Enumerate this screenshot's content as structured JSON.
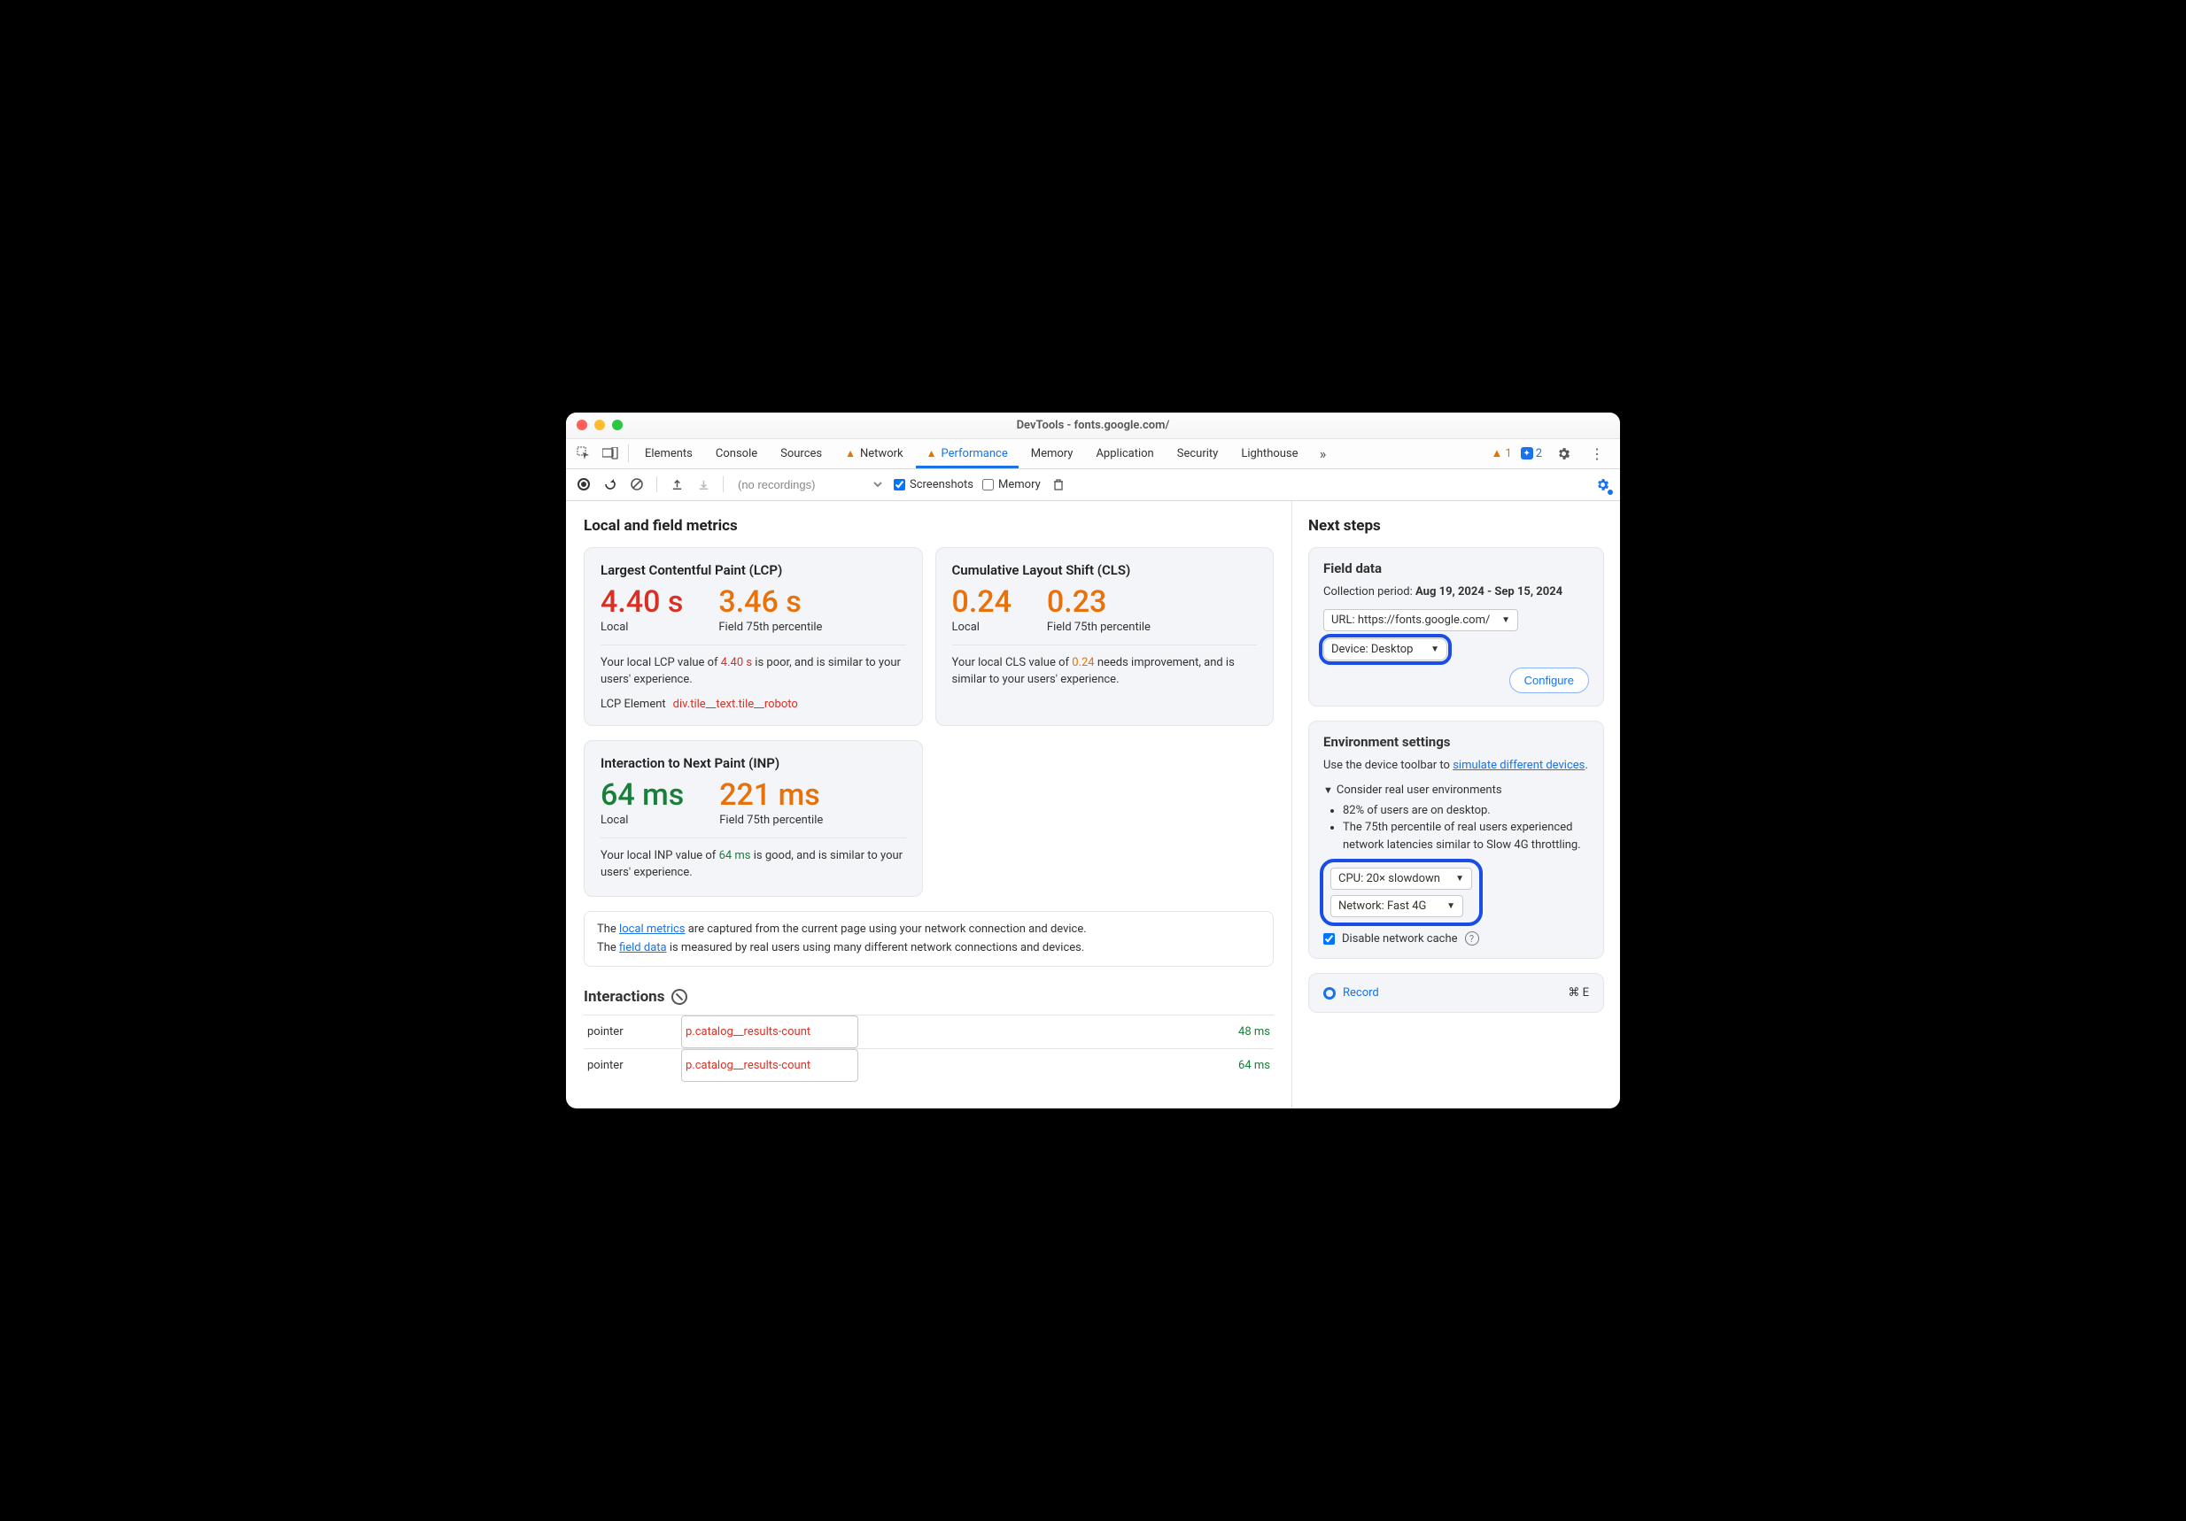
{
  "window_title": "DevTools - fonts.google.com/",
  "tabs": {
    "elements": "Elements",
    "console": "Console",
    "sources": "Sources",
    "network": "Network",
    "performance": "Performance",
    "memory": "Memory",
    "application": "Application",
    "security": "Security",
    "lighthouse": "Lighthouse"
  },
  "top_badges": {
    "warn_count": "1",
    "info_count": "2"
  },
  "toolbar": {
    "recording_placeholder": "(no recordings)",
    "screenshots_label": "Screenshots",
    "memory_label": "Memory"
  },
  "left": {
    "heading": "Local and field metrics",
    "lcp": {
      "title": "Largest Contentful Paint (LCP)",
      "local_val": "4.40 s",
      "local_label": "Local",
      "field_val": "3.46 s",
      "field_label": "Field 75th percentile",
      "desc_a": "Your local LCP value of ",
      "desc_val": "4.40 s",
      "desc_b": " is poor, and is similar to your users' experience.",
      "el_key": "LCP Element",
      "el_val": "div.tile__text.tile__roboto"
    },
    "cls": {
      "title": "Cumulative Layout Shift (CLS)",
      "local_val": "0.24",
      "local_label": "Local",
      "field_val": "0.23",
      "field_label": "Field 75th percentile",
      "desc_a": "Your local CLS value of ",
      "desc_val": "0.24",
      "desc_b": " needs improvement, and is similar to your users' experience."
    },
    "inp": {
      "title": "Interaction to Next Paint (INP)",
      "local_val": "64 ms",
      "local_label": "Local",
      "field_val": "221 ms",
      "field_label": "Field 75th percentile",
      "desc_a": "Your local INP value of ",
      "desc_val": "64 ms",
      "desc_b": " is good, and is similar to your users' experience."
    },
    "note": {
      "l1a": "The ",
      "l1_link": "local metrics",
      "l1b": " are captured from the current page using your network connection and device.",
      "l2a": "The ",
      "l2_link": "field data",
      "l2b": " is measured by real users using many different network connections and devices."
    },
    "interactions_heading": "Interactions",
    "interactions": [
      {
        "type": "pointer",
        "selector": "p.catalog__results-count",
        "time": "48 ms"
      },
      {
        "type": "pointer",
        "selector": "p.catalog__results-count",
        "time": "64 ms"
      }
    ]
  },
  "right": {
    "heading": "Next steps",
    "field": {
      "title": "Field data",
      "period_a": "Collection period: ",
      "period_b": "Aug 19, 2024 - Sep 15, 2024",
      "url_select": "URL: https://fonts.google.com/",
      "device_select": "Device: Desktop",
      "configure": "Configure"
    },
    "env": {
      "title": "Environment settings",
      "hint_a": "Use the device toolbar to ",
      "hint_link": "simulate different devices",
      "hint_b": ".",
      "details_summary": "Consider real user environments",
      "bullet1": "82% of users are on desktop.",
      "bullet2": "The 75th percentile of real users experienced network latencies similar to Slow 4G throttling.",
      "cpu_select": "CPU: 20× slowdown",
      "net_select": "Network: Fast 4G",
      "disable_cache": "Disable network cache"
    },
    "record": {
      "label": "Record",
      "shortcut": "⌘ E"
    }
  }
}
